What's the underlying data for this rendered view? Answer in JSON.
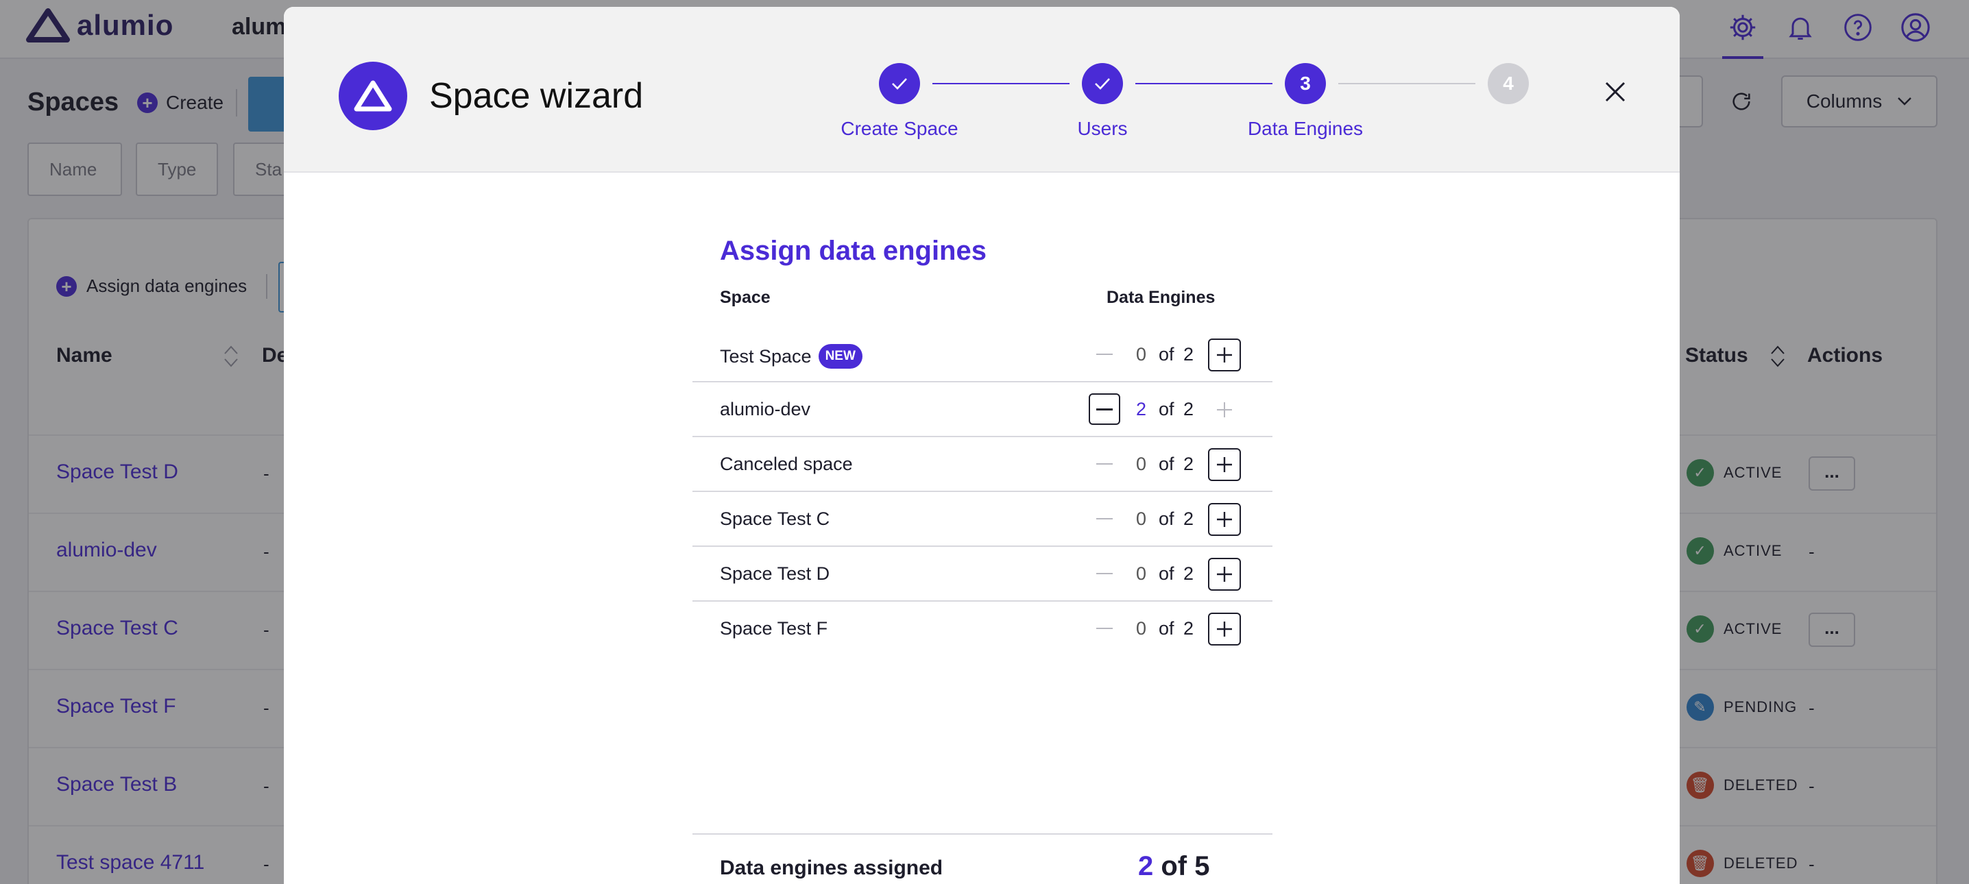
{
  "app": {
    "brand": "alumio",
    "org": "alum"
  },
  "page": {
    "title": "Spaces",
    "create_label": "Create",
    "columns_label": "Columns"
  },
  "filters": [
    "Name",
    "Type",
    "Sta"
  ],
  "table": {
    "assign_label": "Assign data engines",
    "headers": {
      "name": "Name",
      "desc": "De",
      "status": "Status",
      "actions": "Actions"
    },
    "rows": [
      {
        "name": "Space Test D",
        "desc": "-",
        "status": "ACTIVE",
        "status_color": "#3f9a5b",
        "action": "..."
      },
      {
        "name": "alumio-dev",
        "desc": "-",
        "status": "ACTIVE",
        "status_color": "#3f9a5b",
        "action": "-"
      },
      {
        "name": "Space Test C",
        "desc": "-",
        "status": "ACTIVE",
        "status_color": "#3f9a5b",
        "action": "..."
      },
      {
        "name": "Space Test F",
        "desc": "-",
        "status": "PENDING",
        "status_color": "#2f83cf",
        "action": "-"
      },
      {
        "name": "Space Test B",
        "desc": "-",
        "status": "DELETED",
        "status_color": "#d2482c",
        "action": "-"
      },
      {
        "name": "Test space 4711",
        "desc": "-",
        "status": "DELETED",
        "status_color": "#d2482c",
        "action": "-"
      }
    ]
  },
  "wizard": {
    "title": "Space wizard",
    "steps": [
      {
        "label": "Create Space",
        "state": "done",
        "number": "1"
      },
      {
        "label": "Users",
        "state": "done",
        "number": "2"
      },
      {
        "label": "Data Engines",
        "state": "current",
        "number": "3"
      },
      {
        "label": "",
        "state": "future",
        "number": "4"
      }
    ],
    "section_title": "Assign data engines",
    "col_space": "Space",
    "col_engines": "Data Engines",
    "of_label": "of",
    "engines": [
      {
        "space": "Test Space",
        "badge": "NEW",
        "assigned": "0",
        "total": "2"
      },
      {
        "space": "alumio-dev",
        "badge": "",
        "assigned": "2",
        "total": "2"
      },
      {
        "space": "Canceled space",
        "badge": "",
        "assigned": "0",
        "total": "2"
      },
      {
        "space": "Space Test C",
        "badge": "",
        "assigned": "0",
        "total": "2"
      },
      {
        "space": "Space Test D",
        "badge": "",
        "assigned": "0",
        "total": "2"
      },
      {
        "space": "Space Test F",
        "badge": "",
        "assigned": "0",
        "total": "2"
      }
    ],
    "summary_label": "Data engines assigned",
    "summary_assigned": "2",
    "summary_of": "of 5"
  },
  "colors": {
    "accent": "#4a2bd6",
    "brand_dark": "#2b1f66"
  }
}
